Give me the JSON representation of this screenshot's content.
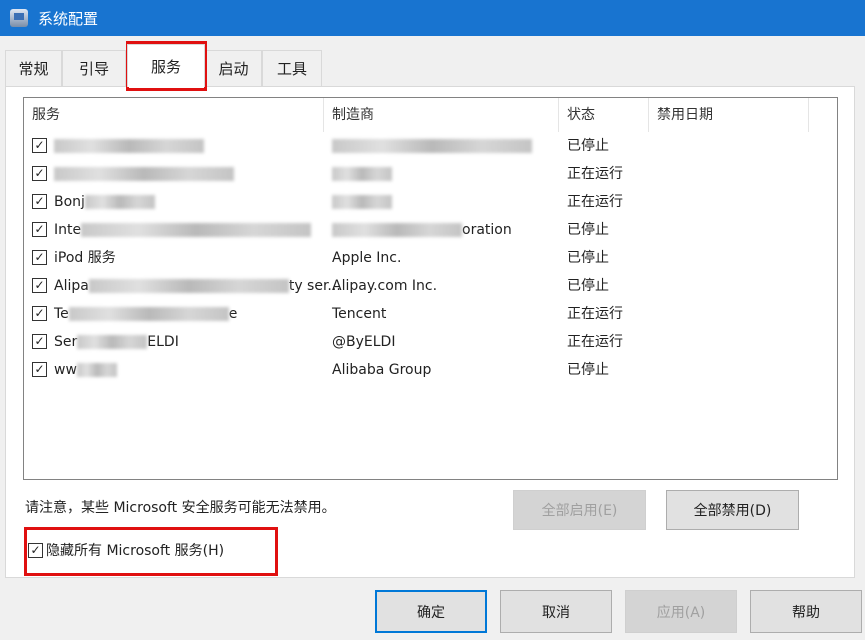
{
  "window": {
    "title": "系统配置",
    "icon": "msconfig-icon"
  },
  "tabs": [
    {
      "label": "常规"
    },
    {
      "label": "引导"
    },
    {
      "label": "服务",
      "selected": true
    },
    {
      "label": "启动"
    },
    {
      "label": "工具"
    }
  ],
  "list": {
    "columns": [
      "服务",
      "制造商",
      "状态",
      "禁用日期"
    ],
    "rows": [
      {
        "checked": true,
        "name": "",
        "vendor": "",
        "status": "已停止"
      },
      {
        "checked": true,
        "name": "",
        "vendor": "",
        "status": "正在运行"
      },
      {
        "checked": true,
        "name": "Bonj",
        "vendor": "",
        "status": "正在运行"
      },
      {
        "checked": true,
        "name": "Inte",
        "vendor": "oration",
        "status": "已停止"
      },
      {
        "checked": true,
        "name": "iPod 服务",
        "vendor": "Apple Inc.",
        "status": "已停止"
      },
      {
        "checked": true,
        "name": "Alipa",
        "name_suffix": "ty ser...",
        "vendor": "Alipay.com Inc.",
        "status": "已停止"
      },
      {
        "checked": true,
        "name": "Te",
        "name_suffix": "e",
        "vendor": "Tencent",
        "status": "正在运行"
      },
      {
        "checked": true,
        "name": "Ser",
        "name_suffix": "ELDI",
        "vendor": "@ByELDI",
        "status": "正在运行"
      },
      {
        "checked": true,
        "name": "ww",
        "vendor": "Alibaba Group",
        "status": "已停止"
      }
    ]
  },
  "note": "请注意，某些 Microsoft 安全服务可能无法禁用。",
  "buttons": {
    "enable_all": "全部启用(E)",
    "disable_all": "全部禁用(D)",
    "ok": "确定",
    "cancel": "取消",
    "apply": "应用(A)",
    "help": "帮助"
  },
  "hide_ms": {
    "label": "隐藏所有 Microsoft 服务(H)",
    "checked": true
  },
  "colors": {
    "titlebar": "#1874d0",
    "highlight": "#e01010",
    "default_button_border": "#0078d7"
  }
}
